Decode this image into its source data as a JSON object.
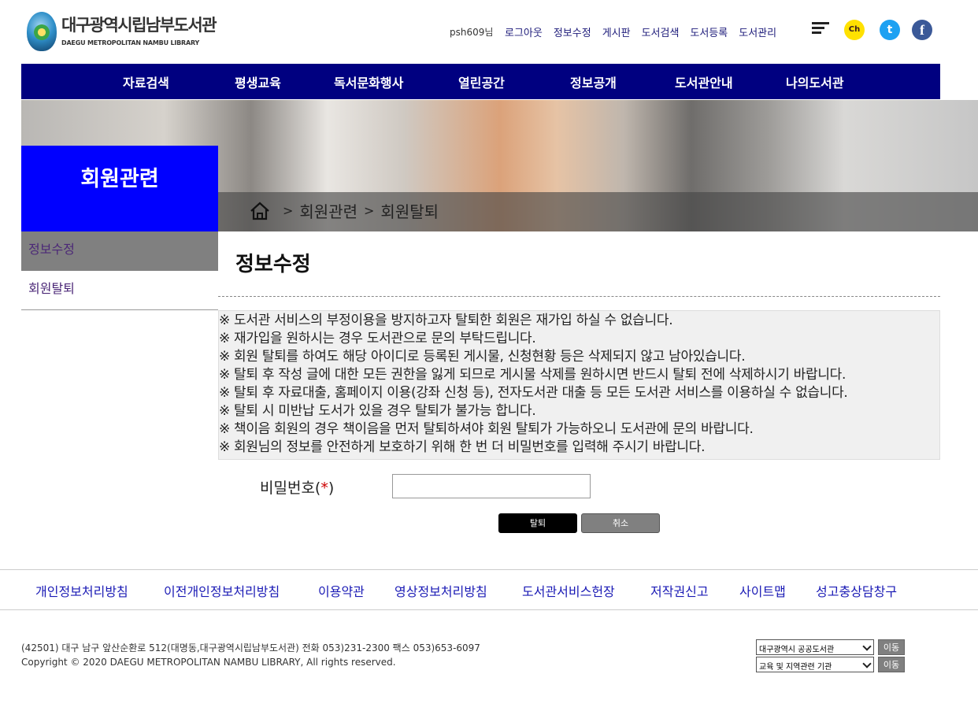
{
  "logo": {
    "title": "대구광역시립남부도서관",
    "subtitle": "DAEGU METROPOLITAN NAMBU LIBRARY"
  },
  "util": {
    "user": "psh609님",
    "links": [
      "로그아웃",
      "정보수정",
      "게시판",
      "도서검색",
      "도서등록",
      "도서관리"
    ],
    "kakao_label": "Ch",
    "twitter_label": "t",
    "facebook_label": "f"
  },
  "gnb": [
    "자료검색",
    "평생교육",
    "독서문화행사",
    "열린공간",
    "정보공개",
    "도서관안내",
    "나의도서관"
  ],
  "breadcrumb": [
    "회원관련",
    "회원탈퇴"
  ],
  "breadcrumb_sep": ">",
  "lnb": {
    "title": "회원관련",
    "items": [
      "정보수정",
      "회원탈퇴"
    ]
  },
  "page_title": "정보수정",
  "notices": [
    "※ 도서관 서비스의 부정이용을 방지하고자 탈퇴한 회원은 재가입 하실 수 없습니다.",
    "※ 재가입을 원하시는 경우 도서관으로 문의 부탁드립니다.",
    "※ 회원 탈퇴를 하여도 해당 아이디로 등록된 게시물, 신청현황 등은 삭제되지 않고 남아있습니다.",
    "※ 탈퇴 후 작성 글에 대한 모든 권한을 잃게 되므로 게시물 삭제를 원하시면 반드시 탈퇴 전에 삭제하시기 바랍니다.",
    "※ 탈퇴 후 자료대출, 홈페이지 이용(강좌 신청 등), 전자도서관 대출 등 모든 도서관 서비스를 이용하실 수 없습니다.",
    "※ 탈퇴 시 미반납 도서가 있을 경우 탈퇴가 불가능 합니다.",
    "※ 책이음 회원의 경우 책이음을 먼저 탈퇴하셔야 회원 탈퇴가 가능하오니 도서관에 문의 바랍니다.",
    "※ 회원님의 정보를 안전하게 보호하기 위해 한 번 더 비밀번호를 입력해 주시기 바랍니다."
  ],
  "form": {
    "password_label": "비밀번호",
    "required_open": "(",
    "required_mark": "*",
    "required_close": ")",
    "password_value": ""
  },
  "buttons": {
    "withdraw": "탈퇴",
    "cancel": "취소"
  },
  "footer_links": [
    "개인정보처리방침",
    "이전개인정보처리방침",
    "이용약관",
    "영상정보처리방침",
    "도서관서비스헌장",
    "저작권신고",
    "사이트맵",
    "성고충상담창구"
  ],
  "footer": {
    "address": "(42501) 대구 남구 앞산순환로 512(대명동,대구광역시립남부도서관) 전화 053)231-2300 팩스 053)653-6097",
    "copyright": "Copyright © 2020 DAEGU METROPOLITAN NAMBU LIBRARY, All rights reserved.",
    "select1": "대구광역시 공공도서관",
    "select2": "교육 및 지역관련 기관",
    "go_label": "이동"
  },
  "colors": {
    "gnb_bg": "#000080",
    "lnb_title_bg": "#0000ff",
    "lnb_active_bg": "#808080",
    "footer_link": "#1a1ab5"
  }
}
